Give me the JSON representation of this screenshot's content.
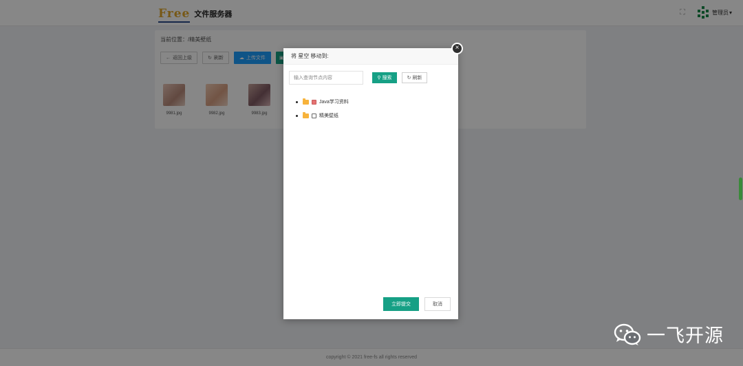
{
  "header": {
    "logo_word": "Free",
    "logo_title": "文件服务器",
    "fullscreen_icon": "fullscreen-icon",
    "user_name": "管理员",
    "user_dropdown_icon": "caret-down-icon"
  },
  "panel": {
    "breadcrumb": "当前位置：/精美壁纸",
    "toolbar": {
      "back": "返回上级",
      "refresh": "刷新",
      "upload": "上传文件"
    },
    "files": [
      {
        "name": "9981.jpg"
      },
      {
        "name": "9982.jpg"
      },
      {
        "name": "9983.jpg"
      }
    ]
  },
  "dialog": {
    "title": "将 星空 移动到:",
    "close_icon": "close-icon",
    "search": {
      "placeholder": "输入查询节点内容",
      "search_label": "搜索",
      "refresh_label": "刷新"
    },
    "tree": [
      {
        "label": "Java学习资料",
        "checked": true
      },
      {
        "label": "精美壁纸",
        "checked": false
      }
    ],
    "submit_label": "立即提交",
    "cancel_label": "取消"
  },
  "footer": {
    "copyright": "copyright © 2021 free-fs all rights reserved"
  },
  "watermark": {
    "text": "一飞开源",
    "icon": "wechat-icon"
  },
  "colors": {
    "primary_green": "#16a085",
    "primary_blue": "#1e9fff",
    "logo_gold": "#e0a72a"
  }
}
